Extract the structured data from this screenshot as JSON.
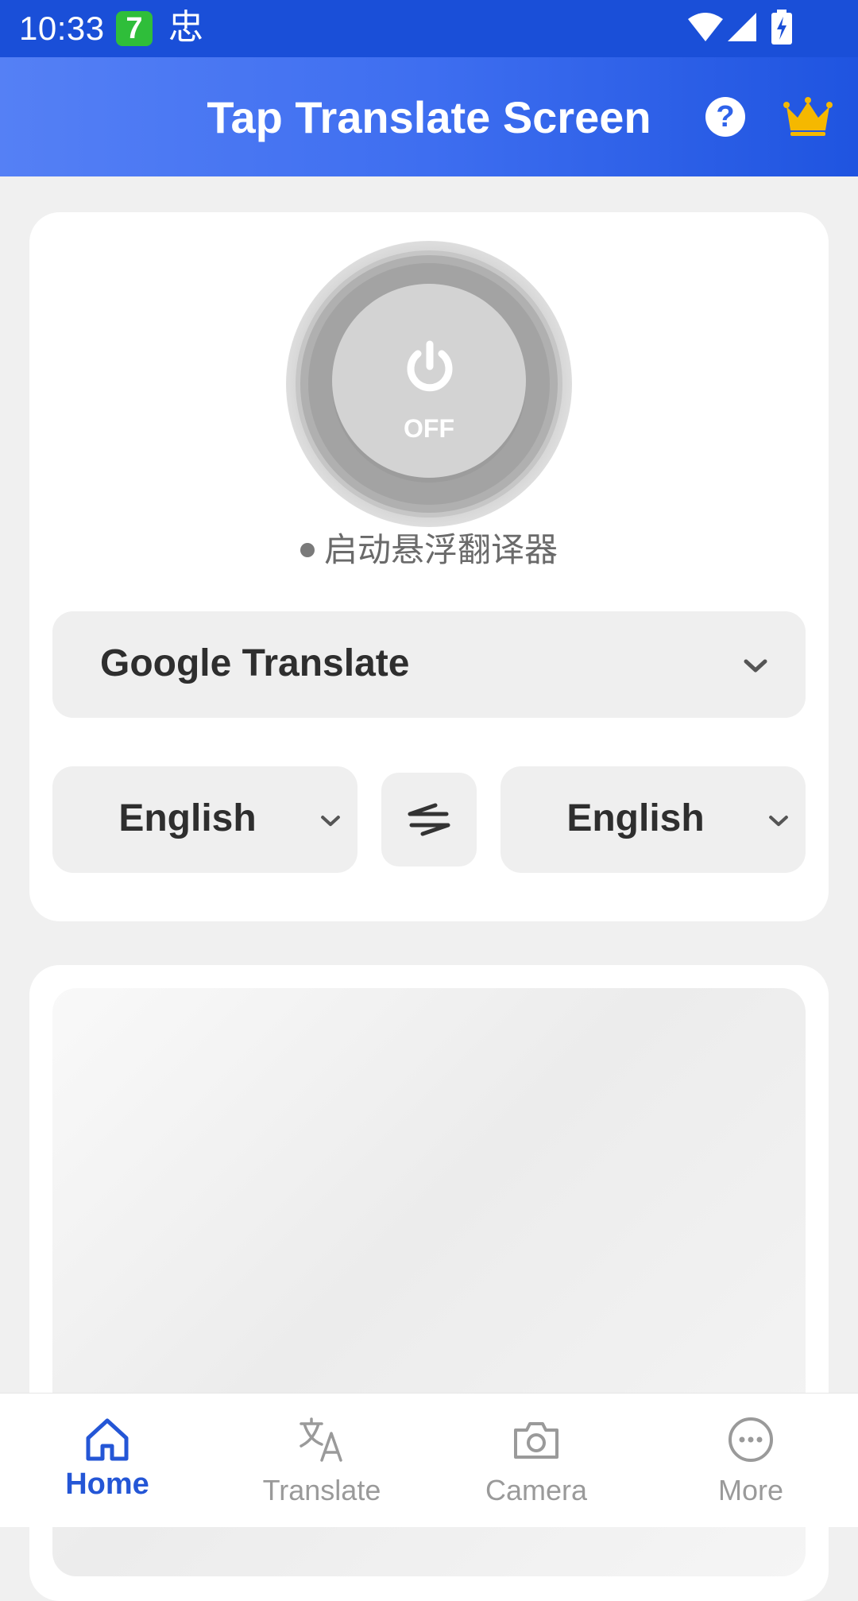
{
  "status_bar": {
    "time": "10:33",
    "badge_number": "7",
    "badge_char": "忠",
    "icons": [
      "wifi-icon",
      "signal-icon",
      "battery-charging-icon"
    ]
  },
  "app_bar": {
    "title": "Tap Translate Screen",
    "help_symbol": "?",
    "premium_icon": "crown-icon",
    "accent_color": "#3e6ef0",
    "crown_color": "#f5b800"
  },
  "power": {
    "label": "OFF",
    "status_text": "启动悬浮翻译器"
  },
  "engine": {
    "selected": "Google Translate"
  },
  "languages": {
    "source": "English",
    "target": "English",
    "swap_icon": "swap-arrows-icon"
  },
  "bottom_nav": {
    "active": "Home",
    "items": [
      {
        "label": "Home",
        "icon": "home-icon"
      },
      {
        "label": "Translate",
        "icon": "translate-icon"
      },
      {
        "label": "Camera",
        "icon": "camera-icon"
      },
      {
        "label": "More",
        "icon": "more-icon"
      }
    ]
  }
}
